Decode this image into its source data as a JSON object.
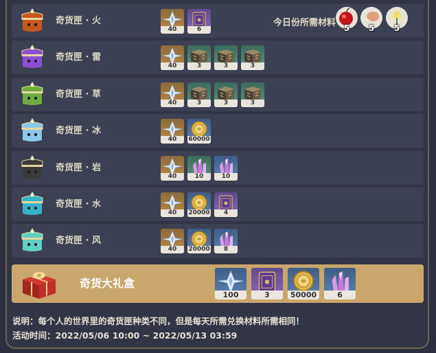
{
  "header": {
    "today_label": "今日份所需材料",
    "foods": [
      {
        "icon": "apple-icon",
        "count": "5"
      },
      {
        "icon": "bird-egg-icon",
        "count": "5"
      },
      {
        "icon": "sweet-flower-icon",
        "count": "5"
      }
    ]
  },
  "rows": [
    {
      "name": "奇货匣 · 火",
      "chest_color": "#c8571e",
      "items": [
        {
          "icon": "primogem-icon",
          "rarity": "orange",
          "count": "40"
        },
        {
          "icon": "hero-wit-book-icon",
          "rarity": "purple",
          "count": "6"
        }
      ]
    },
    {
      "name": "奇货匣 · 雷",
      "chest_color": "#8a4fd0",
      "items": [
        {
          "icon": "primogem-icon",
          "rarity": "orange",
          "count": "40"
        },
        {
          "icon": "talent-book-icon",
          "rarity": "green",
          "count": "3"
        },
        {
          "icon": "talent-book-icon",
          "rarity": "green",
          "count": "3"
        },
        {
          "icon": "talent-book-icon",
          "rarity": "green",
          "count": "3"
        }
      ]
    },
    {
      "name": "奇货匣 · 草",
      "chest_color": "#6fae3e",
      "items": [
        {
          "icon": "primogem-icon",
          "rarity": "orange",
          "count": "40"
        },
        {
          "icon": "talent-book-icon",
          "rarity": "green",
          "count": "3"
        },
        {
          "icon": "talent-book-icon",
          "rarity": "green",
          "count": "3"
        },
        {
          "icon": "talent-book-icon",
          "rarity": "green",
          "count": "3"
        }
      ]
    },
    {
      "name": "奇货匣 · 冰",
      "chest_color": "#8cc7e8",
      "items": [
        {
          "icon": "primogem-icon",
          "rarity": "orange",
          "count": "40"
        },
        {
          "icon": "mora-icon",
          "rarity": "blue",
          "count": "60000"
        }
      ]
    },
    {
      "name": "奇货匣 · 岩",
      "chest_color": "#3b3a3a",
      "items": [
        {
          "icon": "primogem-icon",
          "rarity": "orange",
          "count": "40"
        },
        {
          "icon": "mystic-ore-icon",
          "rarity": "green",
          "count": "10"
        },
        {
          "icon": "mystic-ore-icon",
          "rarity": "blue",
          "count": "10"
        }
      ]
    },
    {
      "name": "奇货匣 · 水",
      "chest_color": "#36b5c9",
      "items": [
        {
          "icon": "primogem-icon",
          "rarity": "orange",
          "count": "40"
        },
        {
          "icon": "mora-icon",
          "rarity": "blue",
          "count": "20000"
        },
        {
          "icon": "hero-wit-book-icon",
          "rarity": "purple",
          "count": "4"
        }
      ]
    },
    {
      "name": "奇货匣 · 风",
      "chest_color": "#5fd0c3",
      "items": [
        {
          "icon": "primogem-icon",
          "rarity": "orange",
          "count": "40"
        },
        {
          "icon": "mora-icon",
          "rarity": "blue",
          "count": "20000"
        },
        {
          "icon": "mystic-ore-icon",
          "rarity": "blue",
          "count": "8"
        }
      ]
    }
  ],
  "gift": {
    "name": "奇货大礼盒",
    "items": [
      {
        "icon": "primogem-icon",
        "rarity": "blue",
        "count": "100"
      },
      {
        "icon": "hero-wit-book-icon",
        "rarity": "purple",
        "count": "3"
      },
      {
        "icon": "mora-icon",
        "rarity": "blue",
        "count": "50000"
      },
      {
        "icon": "mystic-ore-icon",
        "rarity": "blue",
        "count": "6"
      }
    ]
  },
  "footer": {
    "note": "说明：每个人的世界里的奇货匣种类不同，但是每天所需兑换材料所需相同！",
    "time": "活动时间：2022/05/06 10:00 ~ 2022/05/13 03:59"
  }
}
